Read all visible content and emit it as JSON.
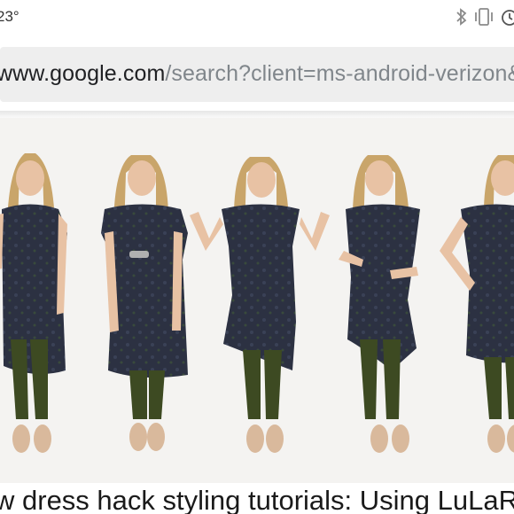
{
  "status_bar": {
    "time": "23°",
    "icons": [
      "bluetooth-icon",
      "vibrate-icon",
      "alarm-icon"
    ]
  },
  "address_bar": {
    "host": "www.google.com",
    "path": "/search?client=ms-android-verizon&"
  },
  "image": {
    "description_subject": "five-pose fashion photo of woman in dark patterned dress with olive leggings and nude flats",
    "colors": {
      "background": "#f4f3f1",
      "dress": "#2c3142",
      "leggings": "#3d4a22",
      "hair": "#c9a56a",
      "skin": "#e8c2a4",
      "shoes": "#d9b99c"
    }
  },
  "caption": {
    "text": "w dress hack styling tutorials: Using LuLaR"
  }
}
